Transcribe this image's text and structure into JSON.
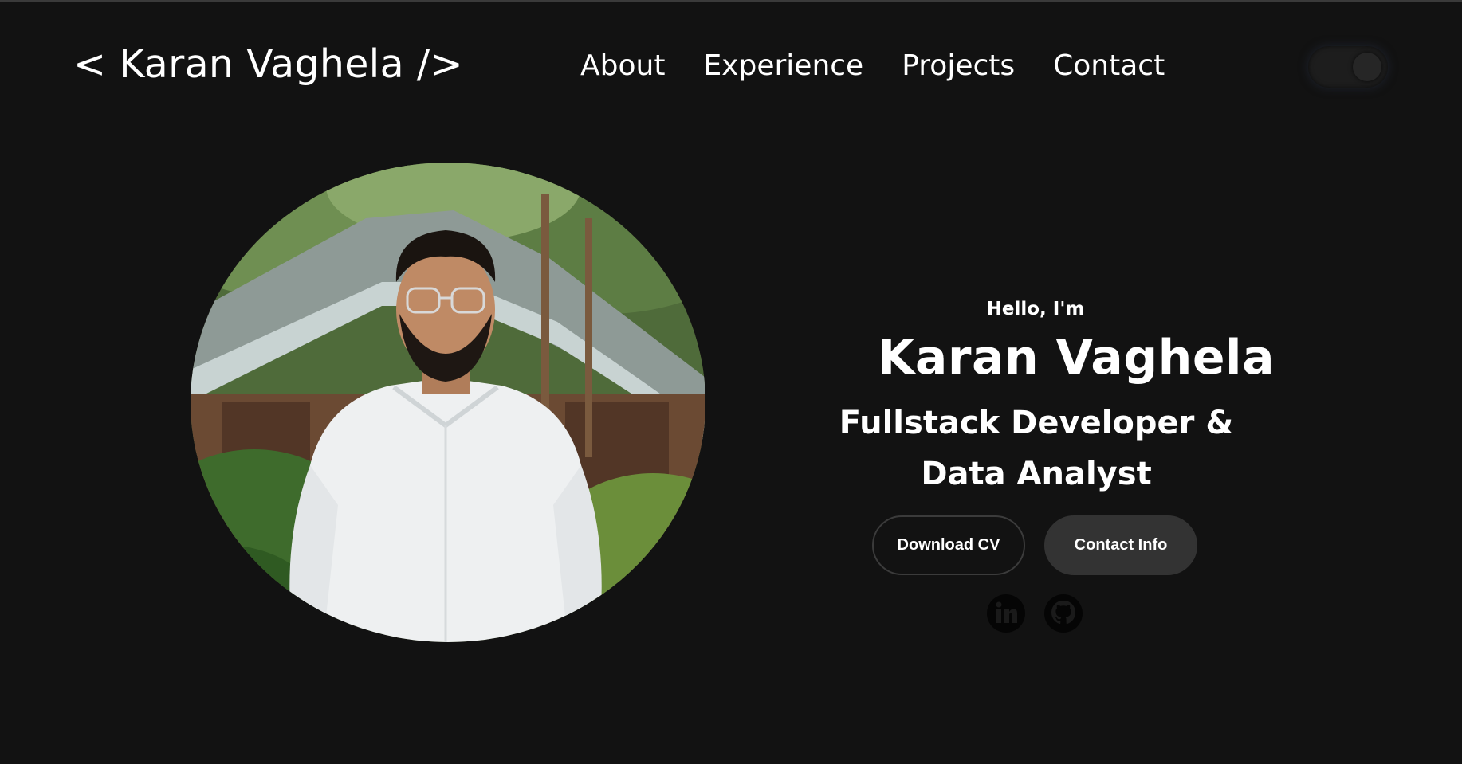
{
  "nav": {
    "logo": "< Karan Vaghela />",
    "links": [
      "About",
      "Experience",
      "Projects",
      "Contact"
    ]
  },
  "hero": {
    "greeting": "Hello, I'm",
    "name": "Karan Vaghela",
    "role": "Fullstack Developer & Data Analyst",
    "buttons": {
      "download_cv": "Download CV",
      "contact_info": "Contact Info"
    },
    "social_icons": [
      "linkedin-icon",
      "github-icon"
    ]
  },
  "colors": {
    "background": "#121212",
    "text": "#ffffff",
    "button_outline": "#3b3b3b",
    "button_fill": "#333333"
  }
}
